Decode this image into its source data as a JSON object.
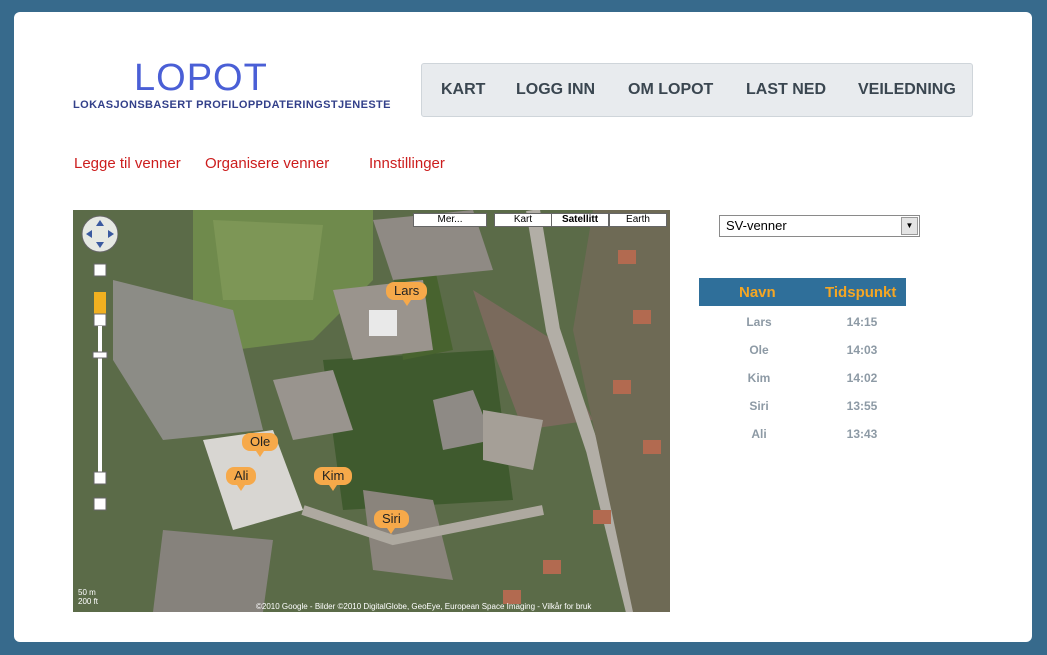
{
  "logo": {
    "title": "LOPOT",
    "subtitle": "LOKASJONSBASERT PROFILOPPDATERINGSTJENESTE"
  },
  "nav": {
    "items": [
      {
        "label": "KART"
      },
      {
        "label": "LOGG INN"
      },
      {
        "label": "OM LOPOT"
      },
      {
        "label": "LAST NED"
      },
      {
        "label": "VEILEDNING"
      }
    ]
  },
  "sublinks": [
    {
      "label": "Legge til venner"
    },
    {
      "label": "Organisere venner"
    },
    {
      "label": "Innstillinger"
    }
  ],
  "map": {
    "type_buttons": [
      "Mer...",
      "Kart",
      "Satellitt",
      "Earth"
    ],
    "selected_type": "Satellitt",
    "markers": [
      "Lars",
      "Ole",
      "Ali",
      "Kim",
      "Siri"
    ],
    "scale_metric": "50 m",
    "scale_imperial": "200 ft",
    "copyright": "©2010 Google - Bilder ©2010 DigitalGlobe, GeoEye, European Space Imaging - Vilkår for bruk"
  },
  "group_select": {
    "value": "SV-venner"
  },
  "friends_table": {
    "headers": {
      "name": "Navn",
      "time": "Tidspunkt"
    },
    "rows": [
      {
        "name": "Lars",
        "time": "14:15"
      },
      {
        "name": "Ole",
        "time": "14:03"
      },
      {
        "name": "Kim",
        "time": "14:02"
      },
      {
        "name": "Siri",
        "time": "13:55"
      },
      {
        "name": "Ali",
        "time": "13:43"
      }
    ]
  },
  "colors": {
    "background": "#376a8c",
    "logo": "#4a5fd6",
    "links": "#cc1d1d",
    "table_header": "#2f6f9a",
    "table_header_text": "#f5a623",
    "marker": "#f6a94a"
  }
}
